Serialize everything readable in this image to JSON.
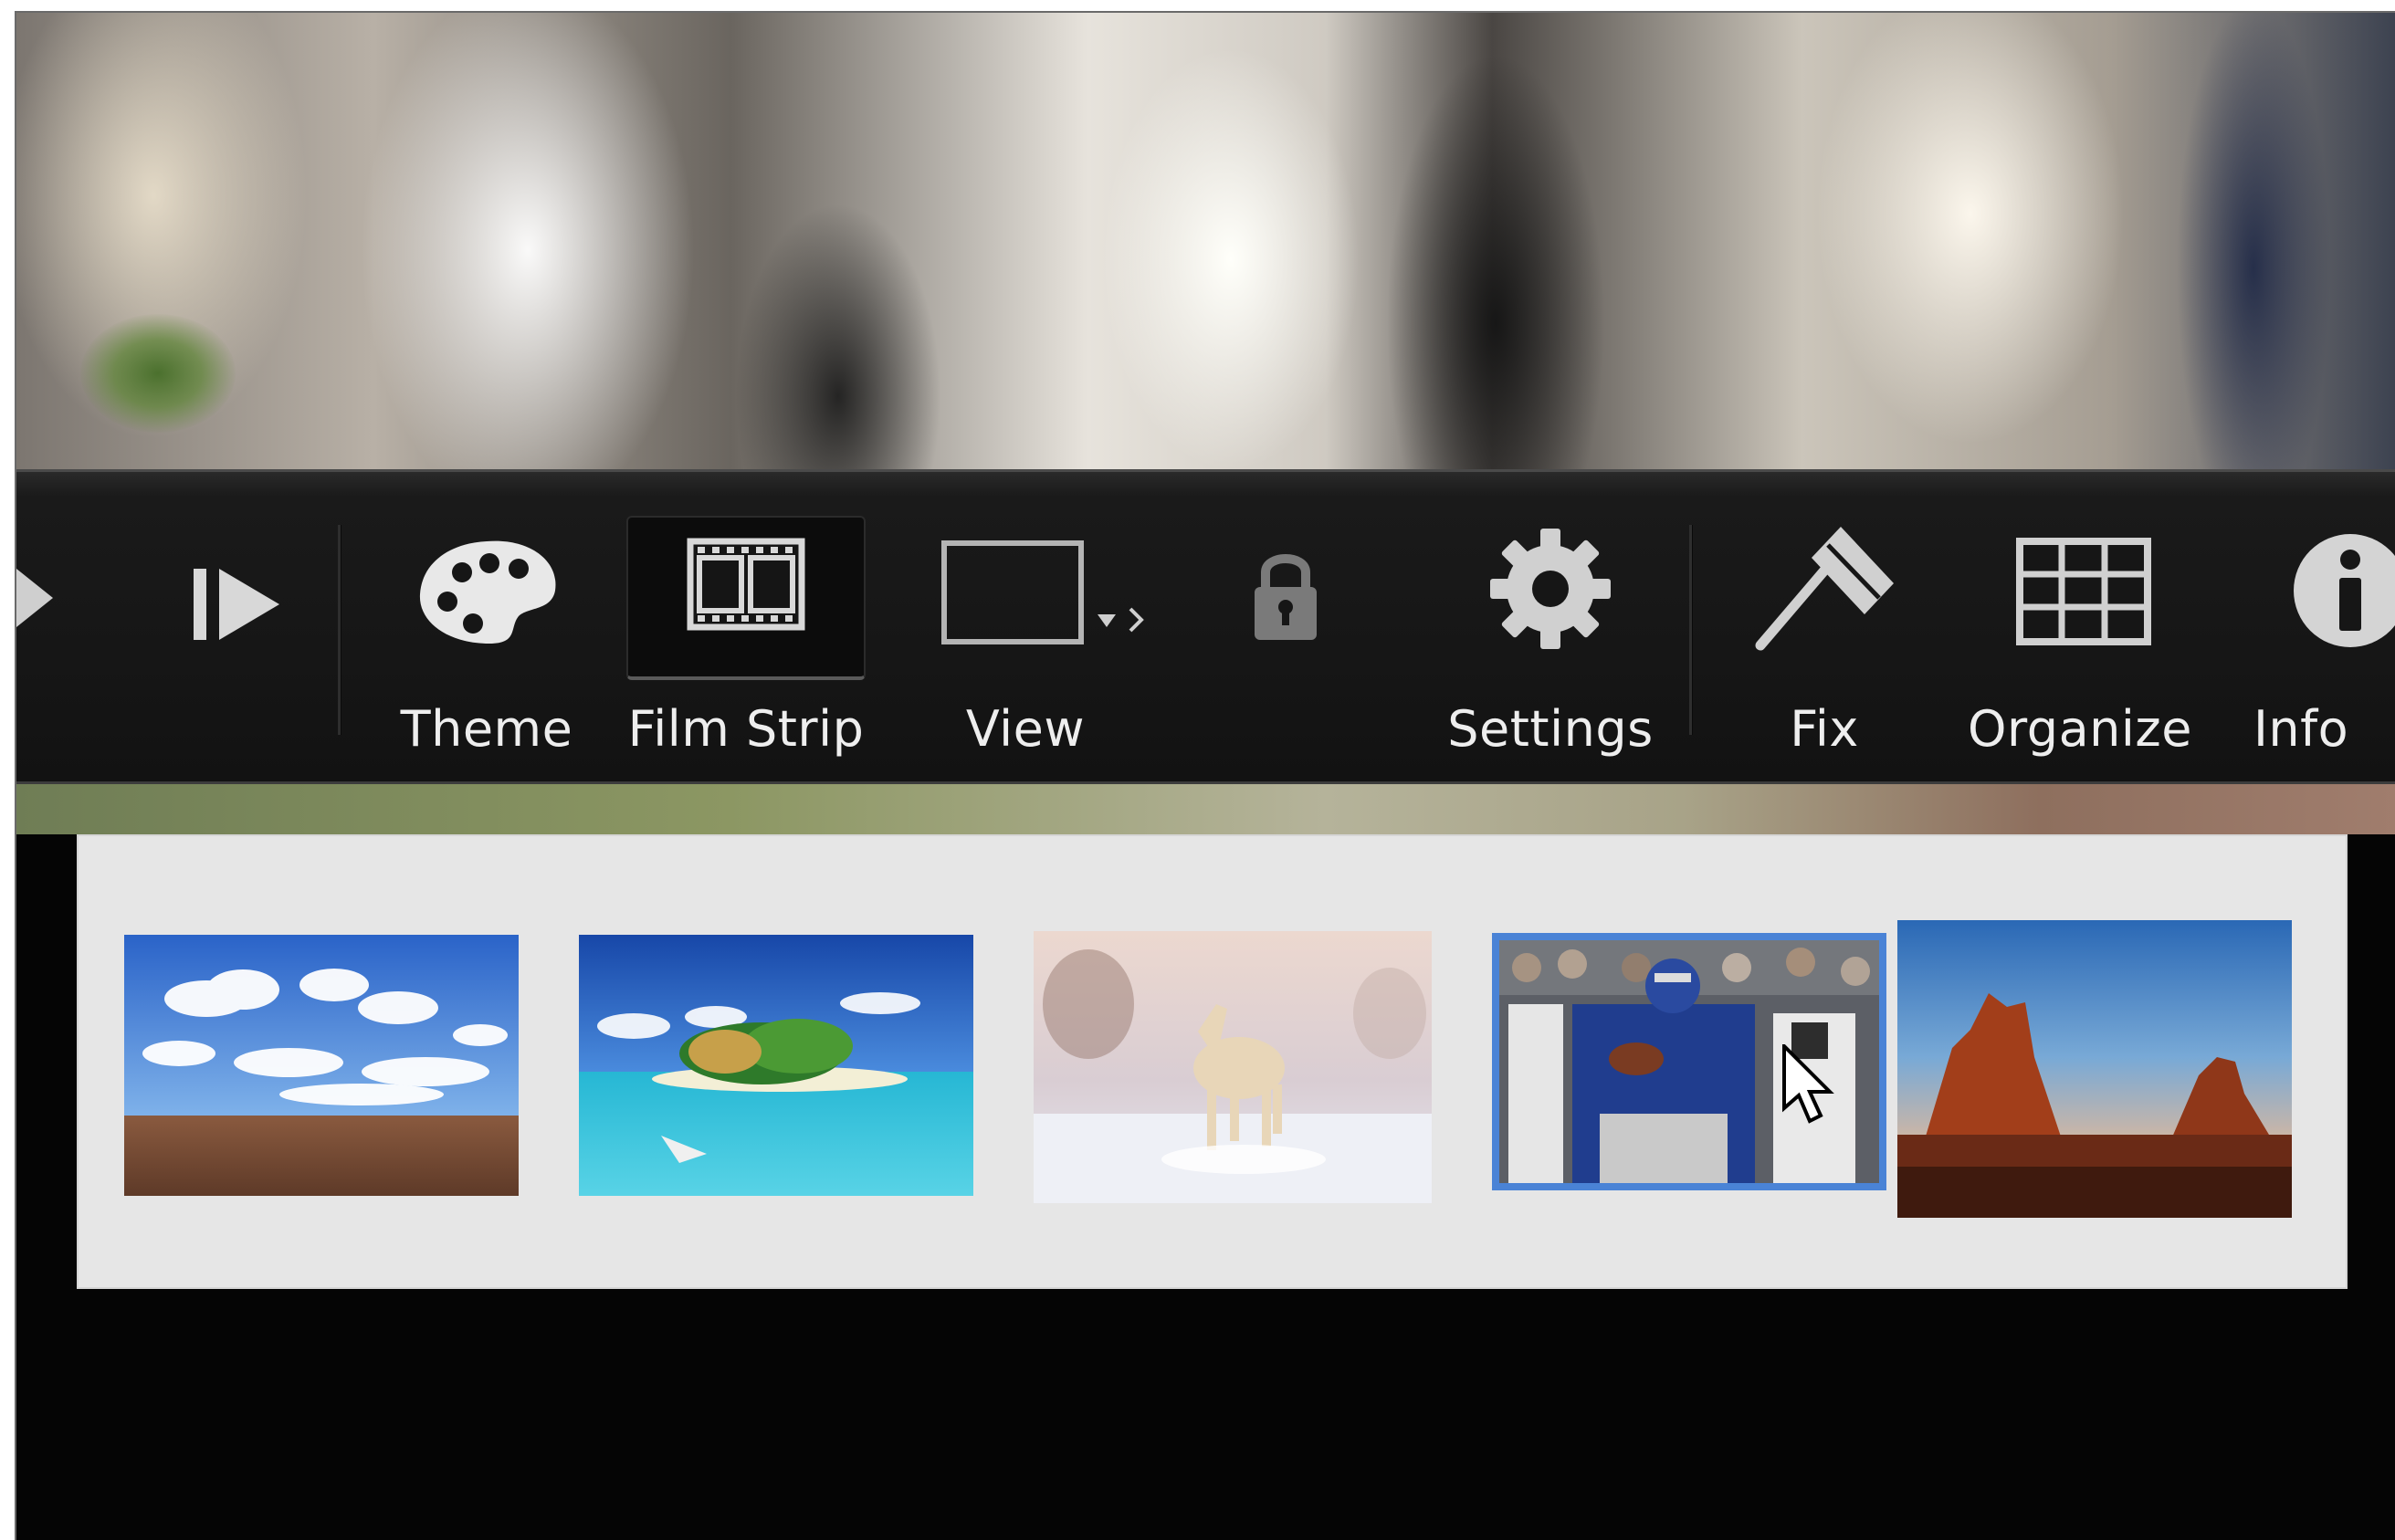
{
  "toolbar": {
    "prev_icon": "play-left-icon",
    "next_icon": "next-slide-icon",
    "items": [
      {
        "label": "Theme",
        "icon": "palette-icon"
      },
      {
        "label": "Film Strip",
        "icon": "filmstrip-icon",
        "active": true
      },
      {
        "label": "View",
        "icon": "view-screen-icon"
      },
      {
        "label": "",
        "icon": "lock-icon"
      },
      {
        "label": "Settings",
        "icon": "gear-icon"
      },
      {
        "label": "Fix",
        "icon": "wand-icon"
      },
      {
        "label": "Organize",
        "icon": "grid-icon"
      },
      {
        "label": "Info",
        "icon": "info-icon"
      }
    ]
  },
  "filmstrip": {
    "thumbnails": [
      {
        "subject": "sky and field",
        "selected": false
      },
      {
        "subject": "tropical island",
        "selected": false
      },
      {
        "subject": "white horse in snow",
        "selected": false
      },
      {
        "subject": "football player",
        "selected": true
      },
      {
        "subject": "desert buttes",
        "selected": false
      }
    ]
  },
  "colors": {
    "toolbar_bg": "#161616",
    "label_text": "#eeeeee",
    "selection": "#4a83d6",
    "filmstrip_bg": "#e6e6e6"
  }
}
